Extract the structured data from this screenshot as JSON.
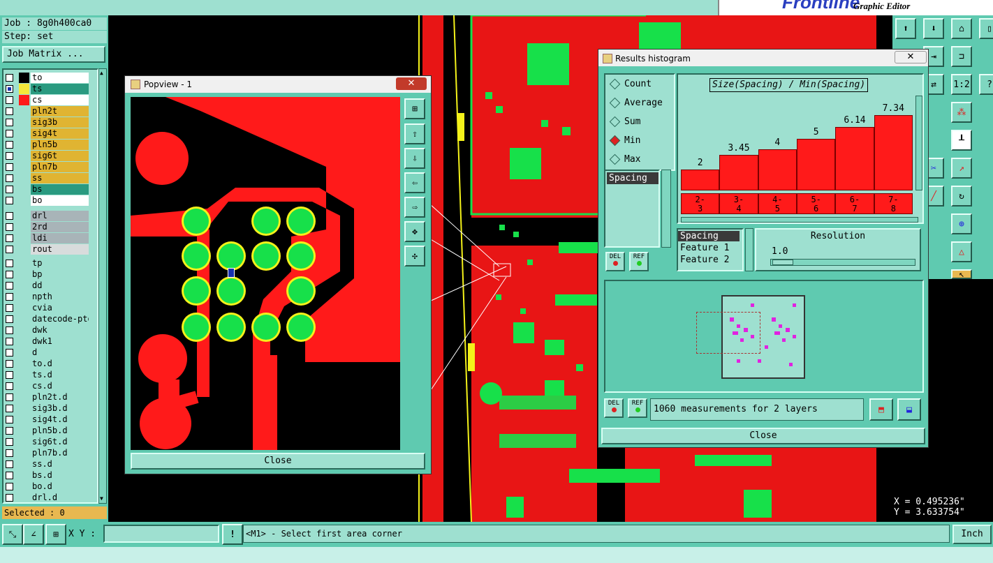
{
  "app": {
    "brand": "Frontline",
    "subtitle": "Graphic Editor"
  },
  "job": {
    "job_label": "Job : 8g0h400ca0",
    "step_label": "Step: set",
    "matrix_button": "Job Matrix ..."
  },
  "layers_group1": [
    {
      "name": "to",
      "color": "#ffffff",
      "swatch": "#000000",
      "checked": false
    },
    {
      "name": "ts",
      "color": "#2a9a80",
      "swatch": "#f4e83a",
      "checked": true
    },
    {
      "name": "cs",
      "color": "#ffffff",
      "swatch": "#ff1a1a",
      "checked": false
    },
    {
      "name": "pln2t",
      "color": "#e0b432",
      "swatch": "",
      "checked": false
    },
    {
      "name": "sig3b",
      "color": "#e0b432",
      "swatch": "",
      "checked": false
    },
    {
      "name": "sig4t",
      "color": "#e0b432",
      "swatch": "",
      "checked": false
    },
    {
      "name": "pln5b",
      "color": "#e0b432",
      "swatch": "",
      "checked": false
    },
    {
      "name": "sig6t",
      "color": "#e0b432",
      "swatch": "",
      "checked": false
    },
    {
      "name": "pln7b",
      "color": "#e0b432",
      "swatch": "",
      "checked": false
    },
    {
      "name": "ss",
      "color": "#e0b432",
      "swatch": "",
      "checked": false
    },
    {
      "name": "bs",
      "color": "#2a9a80",
      "swatch": "",
      "checked": false
    },
    {
      "name": "bo",
      "color": "#ffffff",
      "swatch": "",
      "checked": false
    }
  ],
  "layers_group2": [
    {
      "name": "drl",
      "color": "#a8b4b8"
    },
    {
      "name": "2rd",
      "color": "#a8b4b8"
    },
    {
      "name": "ldi",
      "color": "#a8b4b8"
    },
    {
      "name": "rout",
      "color": "#d8dcdc"
    }
  ],
  "layers_group3": [
    {
      "name": "tp"
    },
    {
      "name": "bp"
    },
    {
      "name": "dd"
    },
    {
      "name": "npth"
    },
    {
      "name": "cvia"
    },
    {
      "name": "datecode-pto"
    },
    {
      "name": "dwk"
    },
    {
      "name": "dwk1"
    },
    {
      "name": "d"
    },
    {
      "name": "to.d"
    },
    {
      "name": "ts.d"
    },
    {
      "name": "cs.d"
    },
    {
      "name": "pln2t.d"
    },
    {
      "name": "sig3b.d"
    },
    {
      "name": "sig4t.d"
    },
    {
      "name": "pln5b.d"
    },
    {
      "name": "sig6t.d"
    },
    {
      "name": "pln7b.d"
    },
    {
      "name": "ss.d"
    },
    {
      "name": "bs.d"
    },
    {
      "name": "bo.d"
    },
    {
      "name": "drl.d"
    }
  ],
  "selected_label": "Selected : 0",
  "popview": {
    "title": "Popview - 1",
    "close_label": "Close"
  },
  "histogram": {
    "title": "Results histogram",
    "radio_options": [
      "Count",
      "Average",
      "Sum",
      "Min",
      "Max"
    ],
    "selected_option": "Min",
    "expression": "Size(Spacing) / Min(Spacing)",
    "list_item": "Spacing",
    "list2": [
      "Spacing",
      "Feature 1",
      "Feature 2"
    ],
    "resolution_label": "Resolution",
    "resolution_value": "1.0",
    "del_label": "DEL",
    "ref_label": "REF",
    "measurements_text": "1060 measurements for 2 layers",
    "close_label": "Close",
    "bar_color": "#ff1a1a"
  },
  "chart_data": {
    "type": "bar",
    "categories": [
      "2-3",
      "3-4",
      "4-5",
      "5-6",
      "6-7",
      "7-8"
    ],
    "values": [
      2,
      3.45,
      4,
      5,
      6.14,
      7.34
    ],
    "value_labels": [
      "2",
      "3.45",
      "4",
      "5",
      "6.14",
      "7.34"
    ],
    "title": "Size(Spacing) / Min(Spacing)",
    "ylim": [
      0,
      8
    ]
  },
  "statusbar": {
    "xy_label": "X Y :",
    "xy_value": "",
    "prompt": "<M1> - Select first area corner",
    "units": "Inch",
    "coord_x": "X = 0.495236\"",
    "coord_y": "Y = 3.633754\""
  },
  "right_toolbar": [
    "1:2",
    "?"
  ]
}
